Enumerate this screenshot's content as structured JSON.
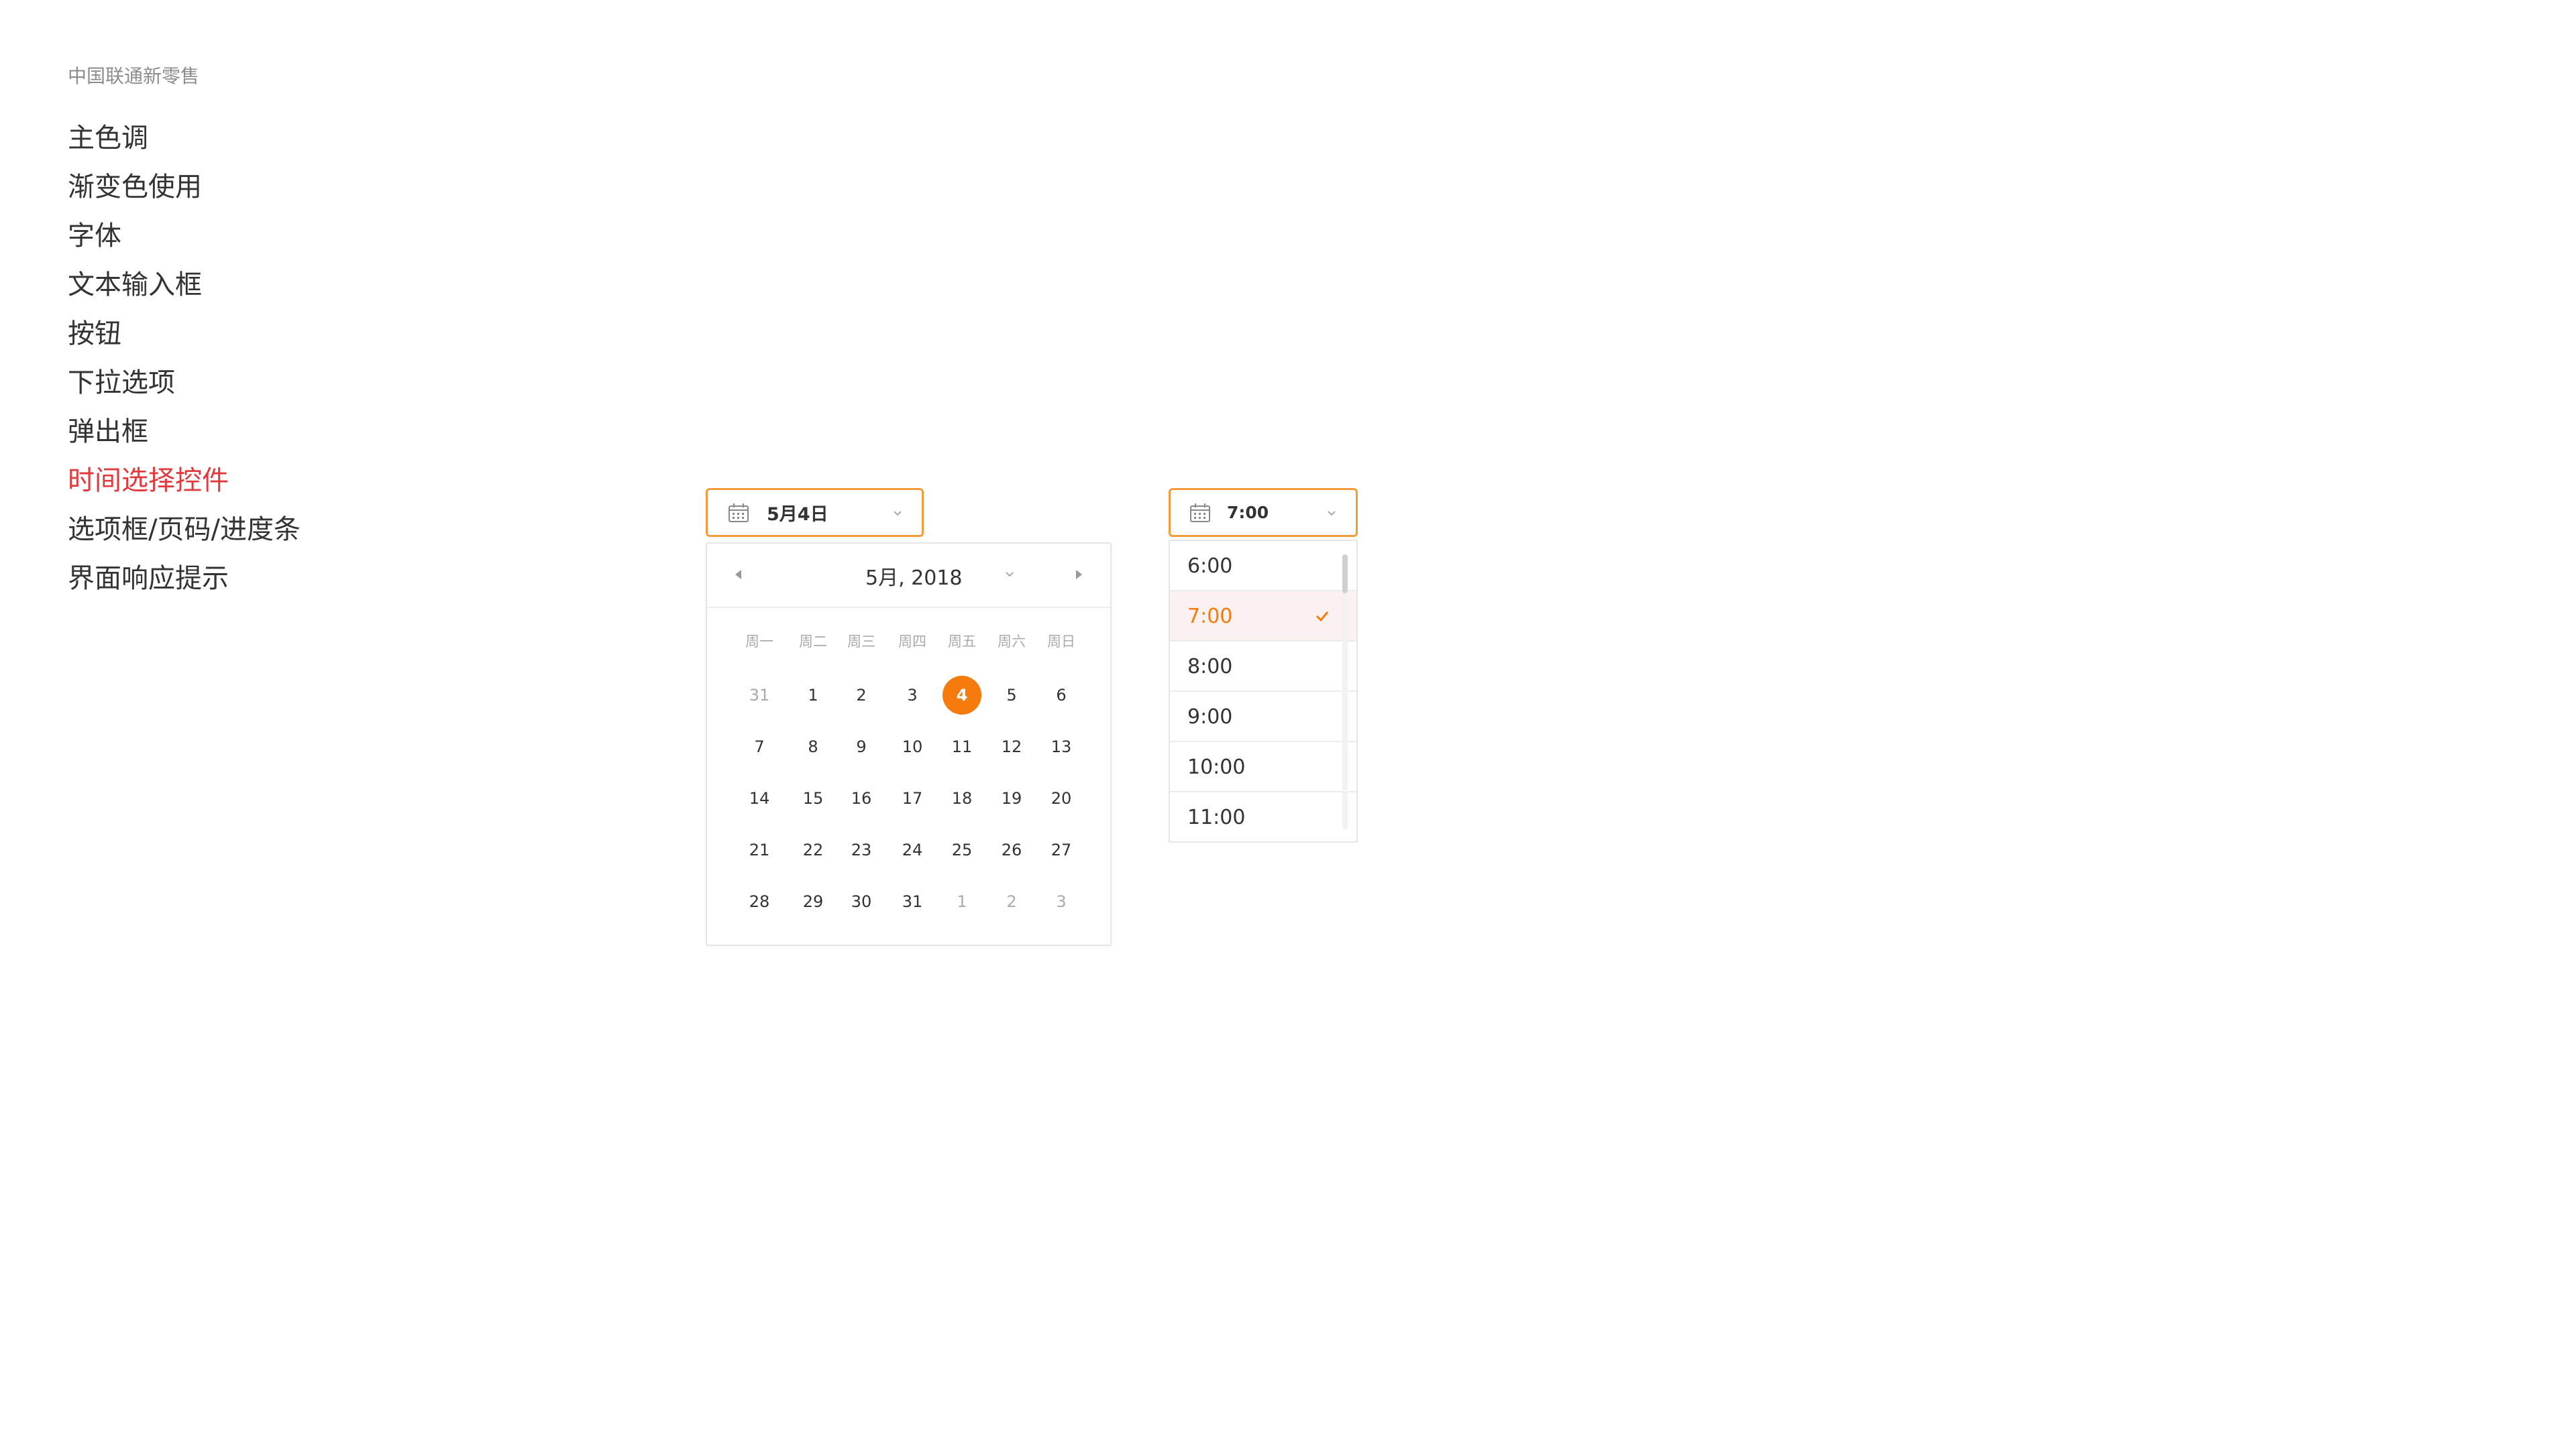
{
  "brand": "中国联通新零售",
  "nav": [
    {
      "label": "主色调"
    },
    {
      "label": "渐变色使用"
    },
    {
      "label": "字体"
    },
    {
      "label": "文本输入框"
    },
    {
      "label": "按钮"
    },
    {
      "label": "下拉选项"
    },
    {
      "label": "弹出框"
    },
    {
      "label": "时间选择控件",
      "active": true
    },
    {
      "label": "选项框/页码/进度条"
    },
    {
      "label": "界面响应提示"
    }
  ],
  "date_picker": {
    "value": "5月4日",
    "header": "5月, 2018",
    "weekdays": [
      "周一",
      "周二",
      "周三",
      "周四",
      "周五",
      "周六",
      "周日"
    ],
    "weeks": [
      [
        "31",
        "1",
        "2",
        "3",
        "4",
        "5",
        "6"
      ],
      [
        "7",
        "8",
        "9",
        "10",
        "11",
        "12",
        "13"
      ],
      [
        "14",
        "15",
        "16",
        "17",
        "18",
        "19",
        "20"
      ],
      [
        "21",
        "22",
        "23",
        "24",
        "25",
        "26",
        "27"
      ],
      [
        "28",
        "29",
        "30",
        "31",
        "1",
        "2",
        "3"
      ]
    ],
    "selected_day": "4",
    "accent_color": "#f47b0c"
  },
  "time_picker": {
    "value": "7:00",
    "options": [
      "6:00",
      "7:00",
      "8:00",
      "9:00",
      "10:00",
      "11:00"
    ],
    "selected": "7:00"
  },
  "colors": {
    "accent": "#f47b0c",
    "nav_active": "#e4393c",
    "field_border": "#f39c3b"
  }
}
